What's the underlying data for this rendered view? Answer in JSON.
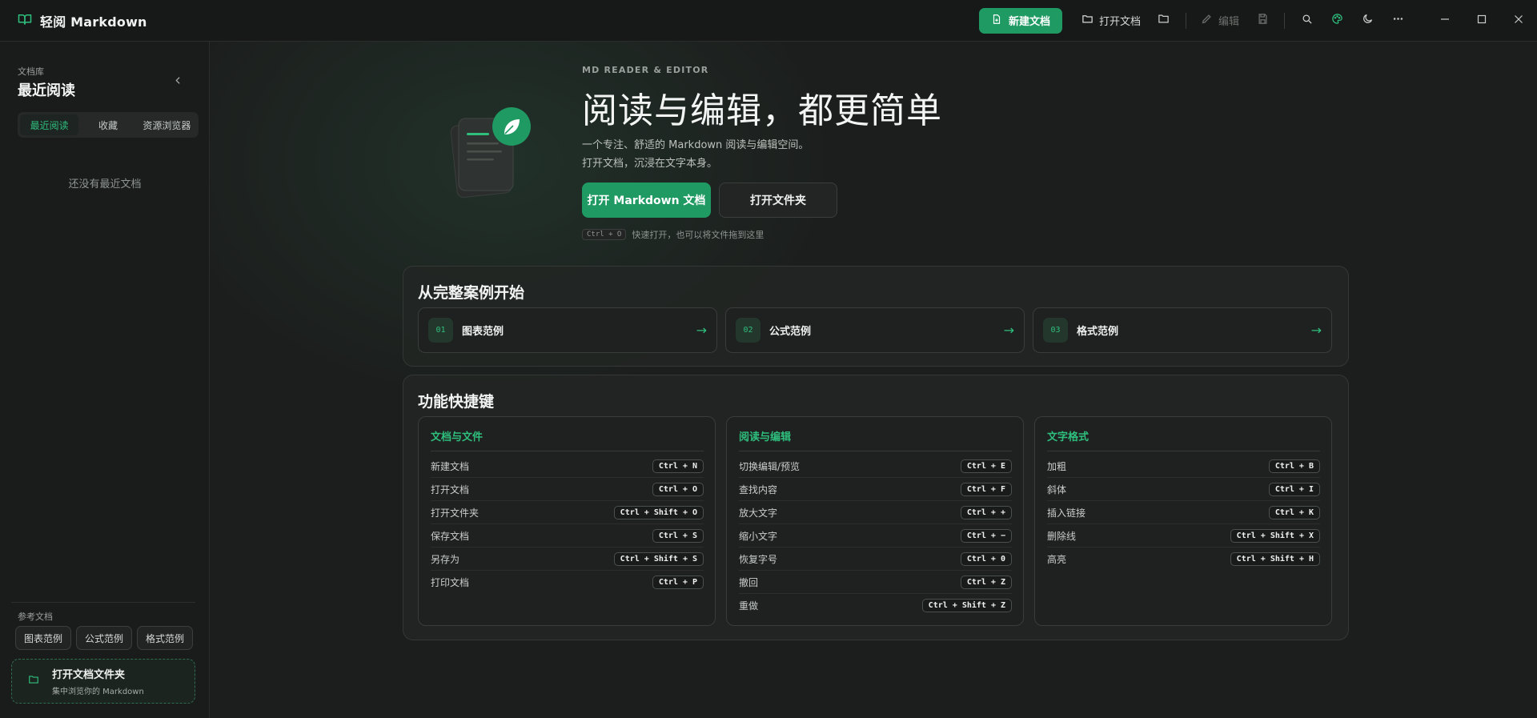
{
  "app": {
    "title": "轻阅 Markdown"
  },
  "toolbar": {
    "new_doc": "新建文档",
    "open_doc": "打开文档",
    "edit": "编辑"
  },
  "sidebar": {
    "caption": "文档库",
    "heading": "最近阅读",
    "tabs": [
      {
        "label": "最近阅读",
        "active": true
      },
      {
        "label": "收藏",
        "active": false
      },
      {
        "label": "资源浏览器",
        "active": false
      }
    ],
    "empty_text": "还没有最近文档",
    "ref_caption": "参考文档",
    "ref_buttons": [
      "图表范例",
      "公式范例",
      "格式范例"
    ],
    "open_folder": {
      "title": "打开文档文件夹",
      "subtitle": "集中浏览你的 Markdown"
    }
  },
  "hero": {
    "eyebrow": "MD READER & EDITOR",
    "title": "阅读与编辑，都更简单",
    "desc_line1": "一个专注、舒适的 Markdown 阅读与编辑空间。",
    "desc_line2": "打开文档，沉浸在文字本身。",
    "primary_button": "打开 Markdown 文档",
    "secondary_button": "打开文件夹",
    "hint_key": "Ctrl + O",
    "hint_text": "快速打开，也可以将文件拖到这里"
  },
  "examples": {
    "title": "从完整案例开始",
    "cards": [
      {
        "num": "01",
        "label": "图表范例",
        "arrow": "→"
      },
      {
        "num": "02",
        "label": "公式范例",
        "arrow": "→"
      },
      {
        "num": "03",
        "label": "格式范例",
        "arrow": "→"
      }
    ]
  },
  "shortcuts": {
    "title": "功能快捷键",
    "groups": [
      {
        "title": "文档与文件",
        "items": [
          {
            "name": "新建文档",
            "key": "Ctrl + N"
          },
          {
            "name": "打开文档",
            "key": "Ctrl + O"
          },
          {
            "name": "打开文件夹",
            "key": "Ctrl + Shift + O"
          },
          {
            "name": "保存文档",
            "key": "Ctrl + S"
          },
          {
            "name": "另存为",
            "key": "Ctrl + Shift + S"
          },
          {
            "name": "打印文档",
            "key": "Ctrl + P"
          }
        ]
      },
      {
        "title": "阅读与编辑",
        "items": [
          {
            "name": "切换编辑/预览",
            "key": "Ctrl + E"
          },
          {
            "name": "查找内容",
            "key": "Ctrl + F"
          },
          {
            "name": "放大文字",
            "key": "Ctrl + +"
          },
          {
            "name": "缩小文字",
            "key": "Ctrl + −"
          },
          {
            "name": "恢复字号",
            "key": "Ctrl + 0"
          },
          {
            "name": "撤回",
            "key": "Ctrl + Z"
          },
          {
            "name": "重做",
            "key": "Ctrl + Shift + Z"
          }
        ]
      },
      {
        "title": "文字格式",
        "items": [
          {
            "name": "加粗",
            "key": "Ctrl + B"
          },
          {
            "name": "斜体",
            "key": "Ctrl + I"
          },
          {
            "name": "插入链接",
            "key": "Ctrl + K"
          },
          {
            "name": "删除线",
            "key": "Ctrl + Shift + X"
          },
          {
            "name": "高亮",
            "key": "Ctrl + Shift + H"
          }
        ]
      }
    ]
  },
  "colors": {
    "accent": "#1f9a63",
    "accent_text": "#2fbf7d",
    "background": "#1c1e1d"
  }
}
